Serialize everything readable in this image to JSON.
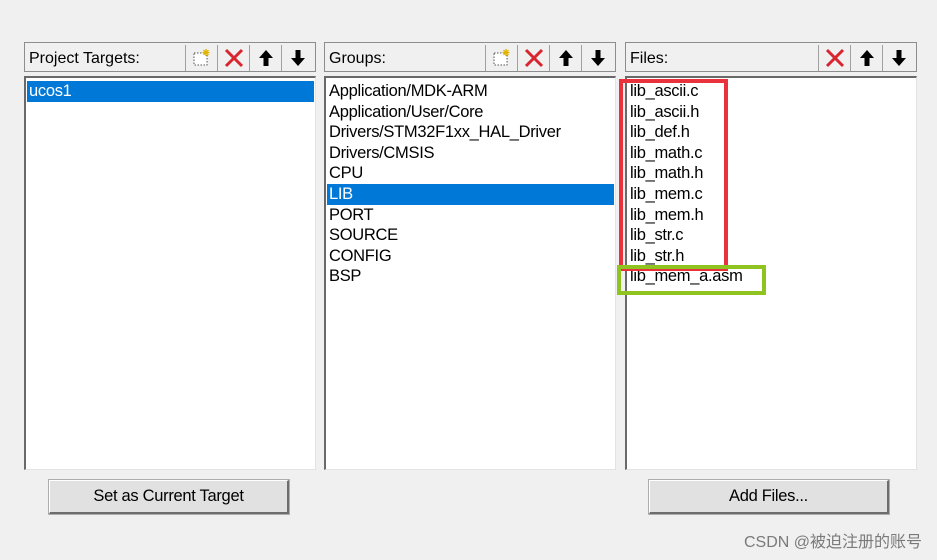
{
  "targets": {
    "title": "Project Targets:",
    "items": [
      {
        "label": "ucos1",
        "selected": true
      }
    ],
    "set_current_button": "Set as Current Target"
  },
  "groups": {
    "title": "Groups:",
    "items": [
      {
        "label": "Application/MDK-ARM",
        "selected": false
      },
      {
        "label": "Application/User/Core",
        "selected": false
      },
      {
        "label": "Drivers/STM32F1xx_HAL_Driver",
        "selected": false
      },
      {
        "label": "Drivers/CMSIS",
        "selected": false
      },
      {
        "label": "CPU",
        "selected": false
      },
      {
        "label": "LIB",
        "selected": true
      },
      {
        "label": "PORT",
        "selected": false
      },
      {
        "label": "SOURCE",
        "selected": false
      },
      {
        "label": "CONFIG",
        "selected": false
      },
      {
        "label": "BSP",
        "selected": false
      }
    ]
  },
  "files": {
    "title": "Files:",
    "items": [
      {
        "label": "lib_ascii.c"
      },
      {
        "label": "lib_ascii.h"
      },
      {
        "label": "lib_def.h"
      },
      {
        "label": "lib_math.c"
      },
      {
        "label": "lib_math.h"
      },
      {
        "label": "lib_mem.c"
      },
      {
        "label": "lib_mem.h"
      },
      {
        "label": "lib_str.c"
      },
      {
        "label": "lib_str.h"
      },
      {
        "label": "lib_mem_a.asm"
      }
    ],
    "add_files_button": "Add Files..."
  },
  "toolbar_icons": {
    "new": "new-icon",
    "delete": "delete-icon",
    "up": "move-up-icon",
    "down": "move-down-icon"
  },
  "colors": {
    "selection": "#0078d7",
    "highlight_red": "#e9323b",
    "highlight_green": "#8fc31f",
    "delete_icon": "#d7262f"
  },
  "watermark": "CSDN @被迫注册的账号"
}
